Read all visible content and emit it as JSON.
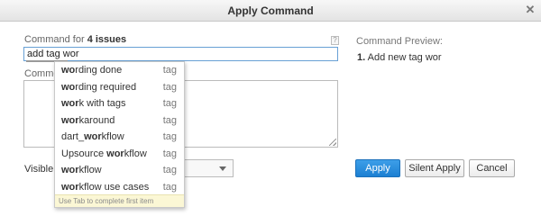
{
  "dialog": {
    "title": "Apply Command",
    "close_glyph": "✕"
  },
  "command": {
    "label_prefix": "Command for",
    "issue_count": "4 issues",
    "help_glyph": "?",
    "input_value": "add tag wor"
  },
  "comment": {
    "label": "Comme",
    "value": ""
  },
  "visibility": {
    "label": "Visible f",
    "selected": ""
  },
  "preview": {
    "label": "Command Preview:",
    "item_number": "1.",
    "item_text": "Add new tag wor"
  },
  "suggestions": [
    {
      "match": "wo",
      "rest": "rding done",
      "kind": "tag"
    },
    {
      "match": "wo",
      "rest": "rding required",
      "kind": "tag"
    },
    {
      "match": "wor",
      "rest": "k with tags",
      "kind": "tag"
    },
    {
      "match": "wor",
      "rest": "karound",
      "kind": "tag"
    },
    {
      "prefix": "dart_",
      "match": "wor",
      "rest": "kflow",
      "kind": "tag"
    },
    {
      "prefix": "Upsource ",
      "match": "wor",
      "rest": "kflow",
      "kind": "tag"
    },
    {
      "match": "wor",
      "rest": "kflow",
      "kind": "tag"
    },
    {
      "match": "wor",
      "rest": "kflow use cases",
      "kind": "tag"
    }
  ],
  "suggestion_hint": "Use Tab to complete first item",
  "buttons": {
    "apply": "Apply",
    "silent_apply": "Silent Apply",
    "cancel": "Cancel"
  },
  "colors": {
    "accent": "#1c7fd2",
    "input_focus_border": "#68a0d5",
    "hint_background": "#fbf7d5"
  },
  "icons": {
    "close": "close-icon",
    "help": "help-icon",
    "dropdown_arrow": "chevron-down-icon",
    "resize": "resize-grip-icon"
  }
}
